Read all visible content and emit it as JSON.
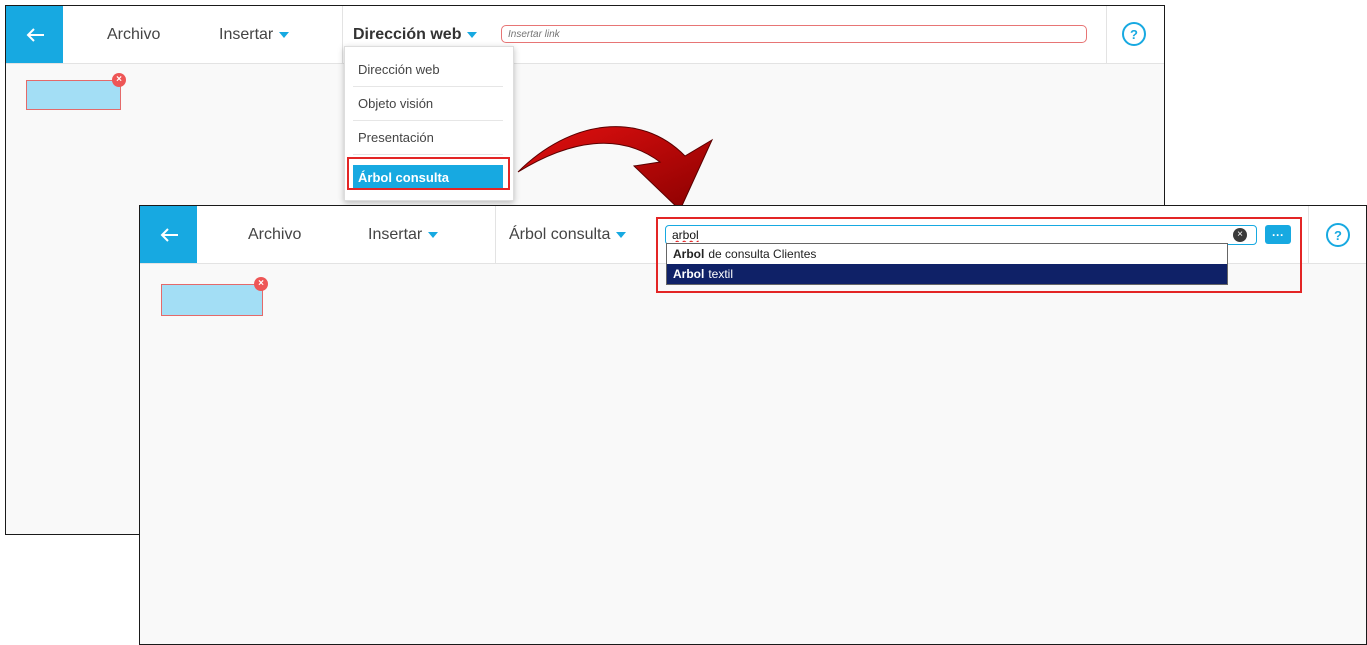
{
  "before": {
    "toolbar": {
      "back_icon": "arrow-left-icon",
      "archivo": "Archivo",
      "insertar": "Insertar",
      "direccion_web": "Dirección web",
      "link_placeholder": "Insertar link",
      "help_icon": "?"
    },
    "dropdown": {
      "items": [
        "Dirección web",
        "Objeto visión",
        "Presentación",
        "Árbol consulta"
      ],
      "selected": "Árbol consulta"
    },
    "close_badge": "×"
  },
  "after": {
    "toolbar": {
      "back_icon": "arrow-left-icon",
      "archivo": "Archivo",
      "insertar": "Insertar",
      "arbol_consulta": "Árbol consulta",
      "search_value": "arbol",
      "clear_icon": "×",
      "more_icon": "···",
      "help_icon": "?"
    },
    "autocomplete": [
      {
        "match": "Arbol",
        "rest": "de consulta Clientes"
      },
      {
        "match": "Arbol",
        "rest": "textil"
      }
    ],
    "close_badge": "×"
  },
  "colors": {
    "accent": "#17a9e1",
    "highlight": "#e32525",
    "selected_row": "#0f2167",
    "box_fill": "#a3def5"
  }
}
